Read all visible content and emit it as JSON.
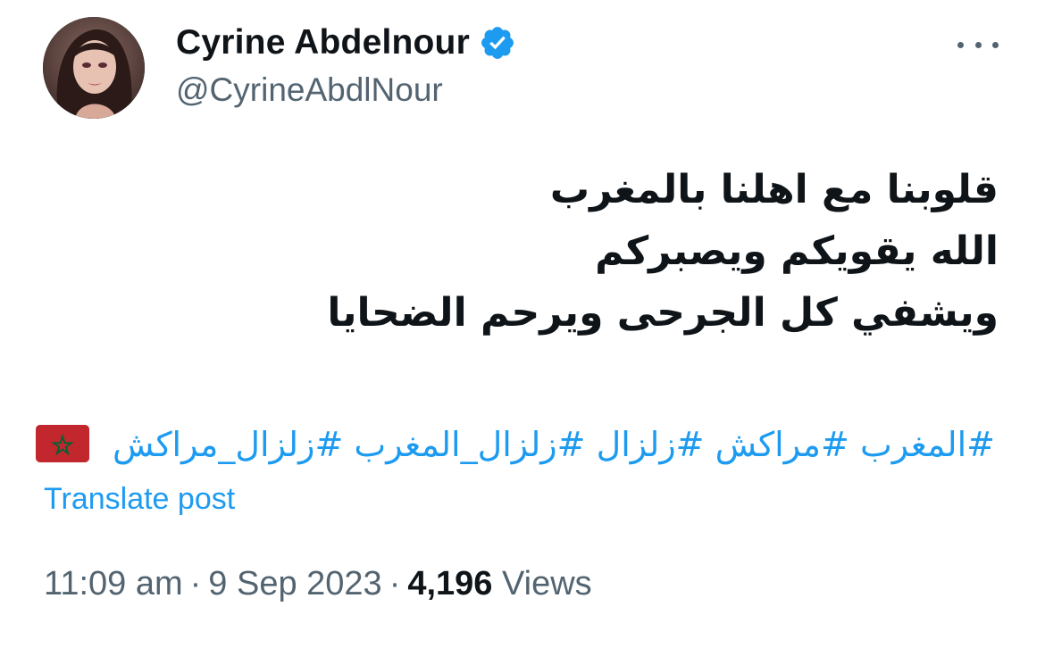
{
  "author": {
    "display_name": "Cyrine Abdelnour",
    "handle": "@CyrineAbdlNour",
    "verified": true,
    "avatar_icon": "profile-photo"
  },
  "menu": {
    "more_icon": "more-dots-icon"
  },
  "post": {
    "lines": [
      "قلوبنا مع اهلنا بالمغرب",
      "الله يقويكم ويصبركم",
      "ويشفي كل الجرحى ويرحم الضحايا"
    ],
    "hashtags": [
      "#المغرب",
      "#مراكش",
      "#زلزال",
      "#زلزال_المغرب",
      "#زلزال_مراكش"
    ],
    "flag_icon": "morocco-flag-icon"
  },
  "translate_label": "Translate post",
  "meta": {
    "time": "11:09 am",
    "date": "9 Sep 2023",
    "views_count": "4,196",
    "views_label": "Views",
    "separator": "·"
  },
  "colors": {
    "accent": "#1d9bf0",
    "text": "#0f1419",
    "secondary": "#536471",
    "flag_red": "#c1272d",
    "flag_green": "#006233"
  }
}
